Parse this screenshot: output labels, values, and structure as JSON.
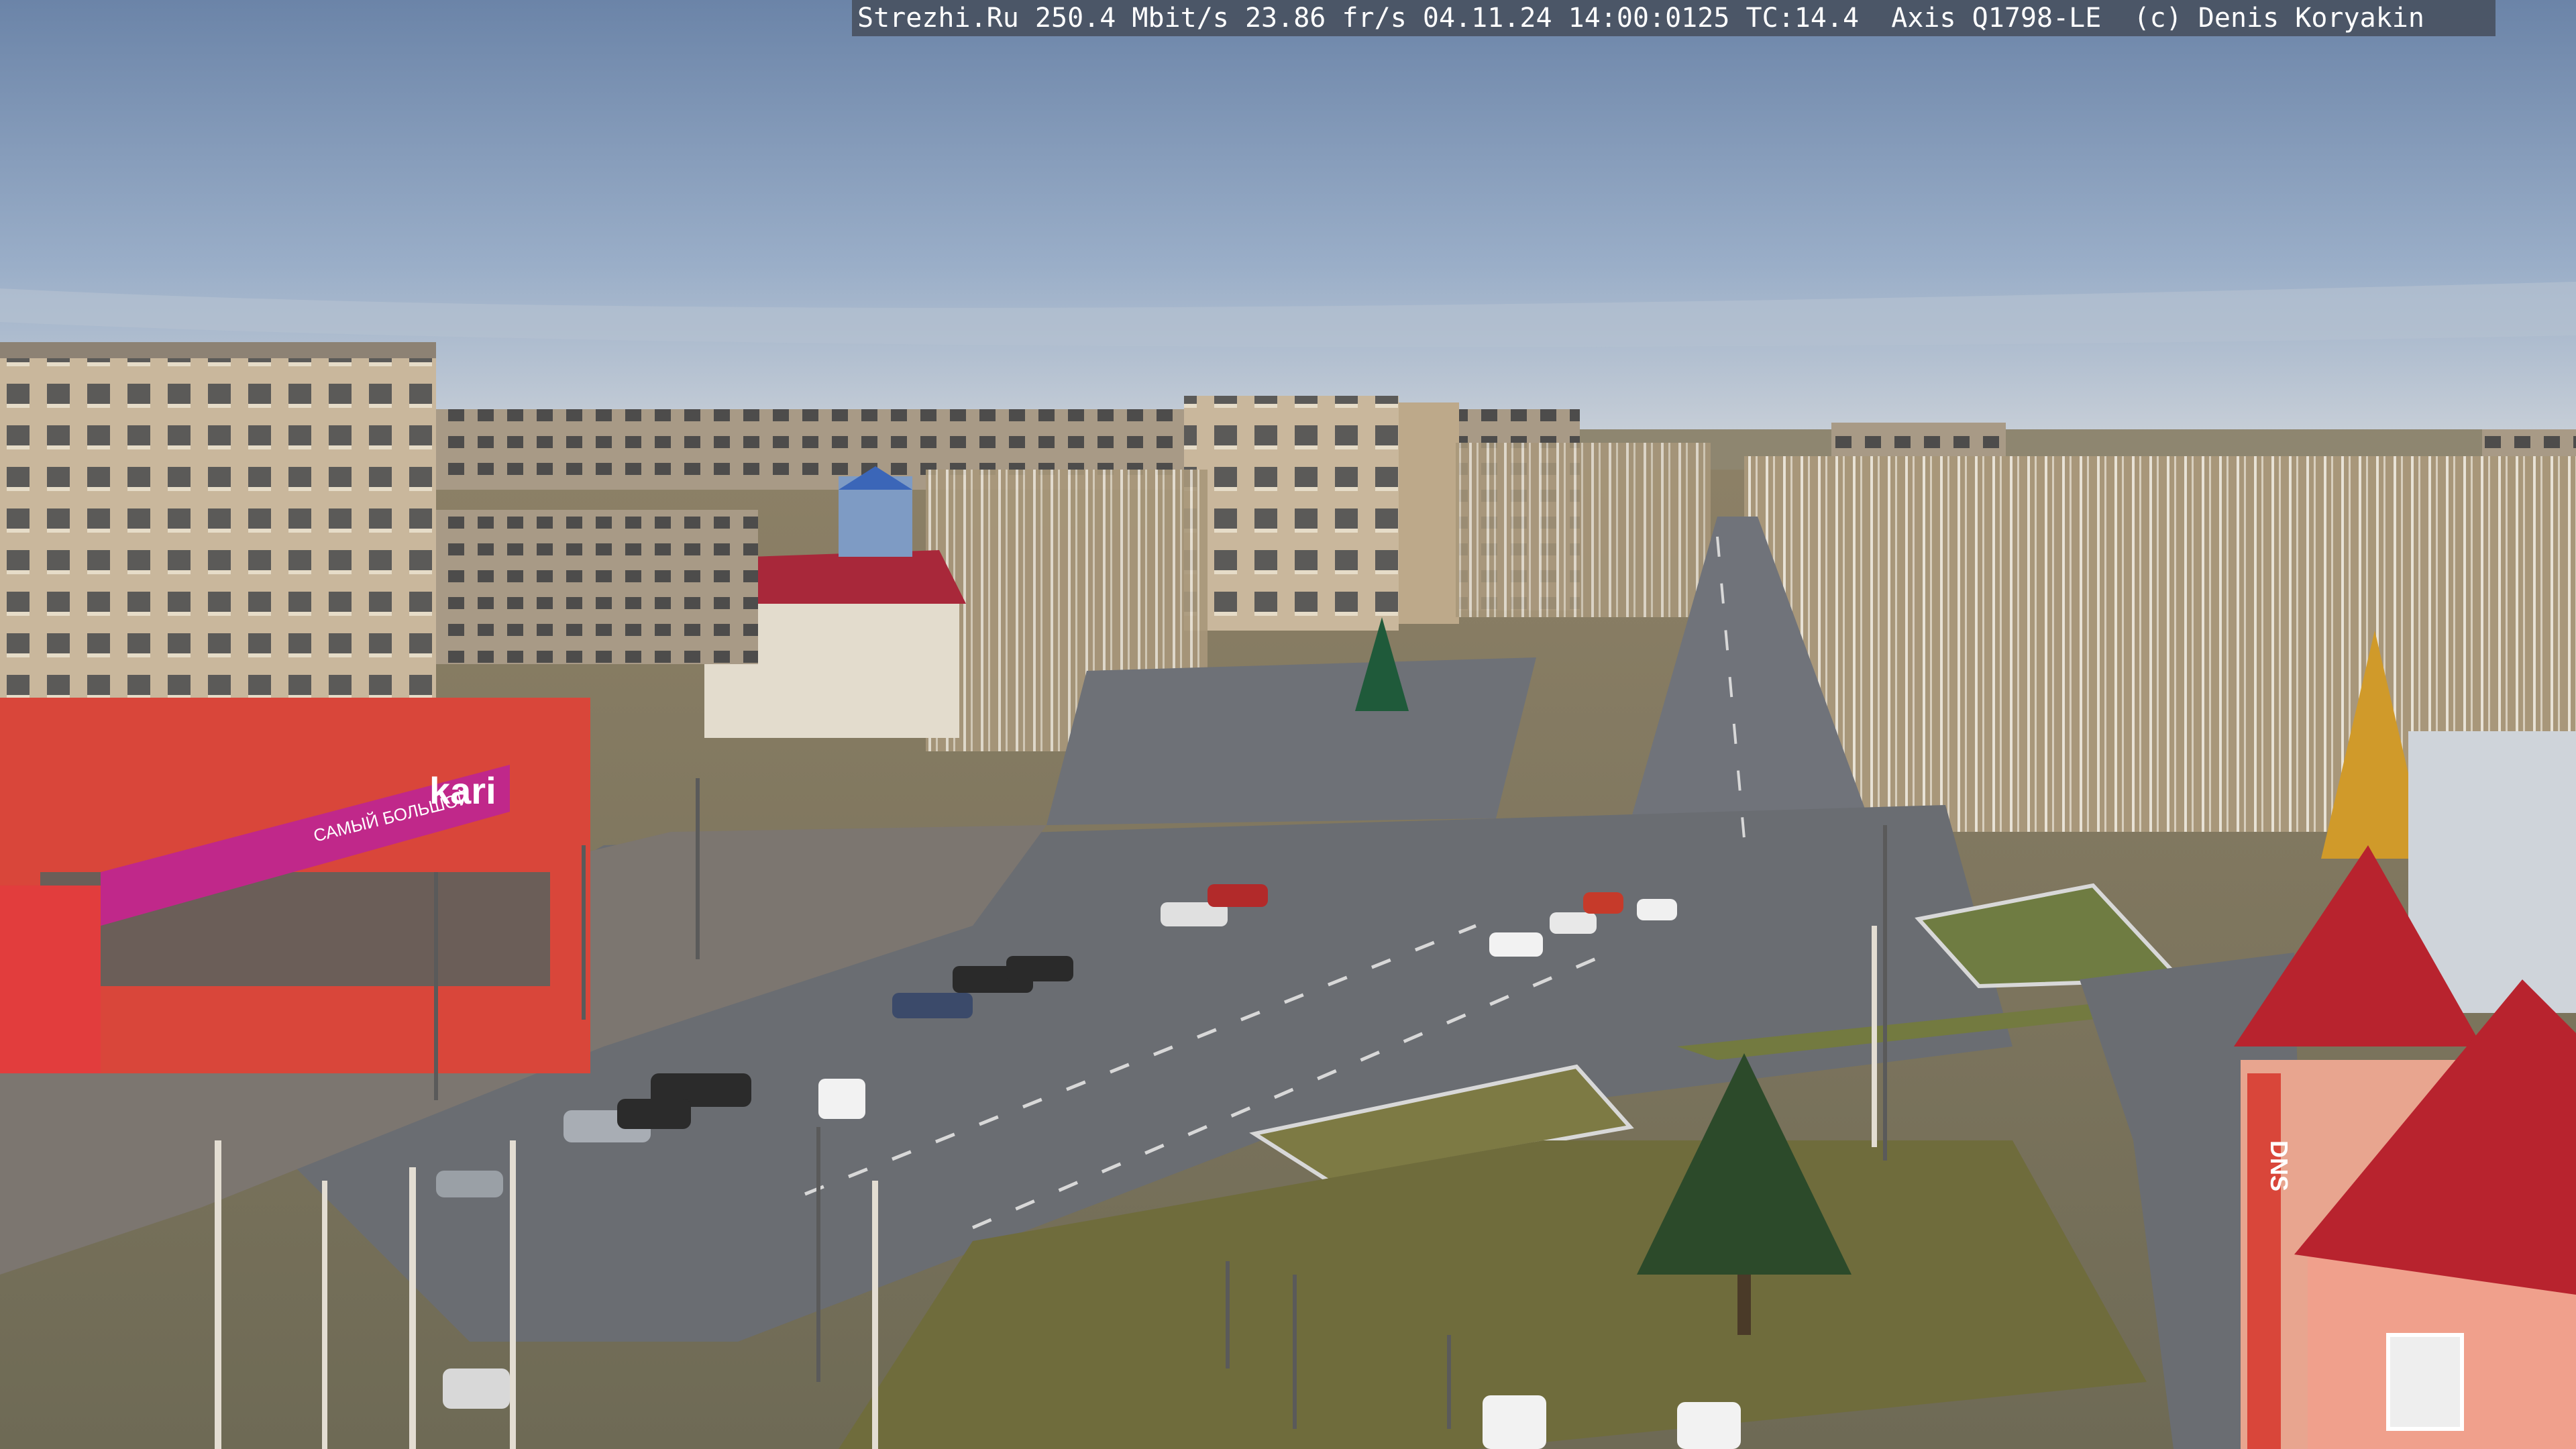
{
  "overlay": {
    "text": "Strezhi.Ru 250.4 Mbit/s 23.86 fr/s 04.11.24 14:00:0125 TC:14.4  Axis Q1798-LE  (c) Denis Koryakin"
  },
  "storefront": {
    "kari_sign": "kari",
    "kari_banner": "САМЫЙ БОЛЬШОЙ",
    "dns_sign": "DNS"
  },
  "colors": {
    "sky_top": "#6f88ab",
    "sky_bottom": "#c7ced6",
    "asphalt": "#6a6d72",
    "apartment": "#c9b79c",
    "storefront_red": "#d9463a",
    "storefront_pink": "#c0288a",
    "roof_red": "#b8232e",
    "grass": "#7d7a44",
    "birch": "#b9a98e"
  }
}
